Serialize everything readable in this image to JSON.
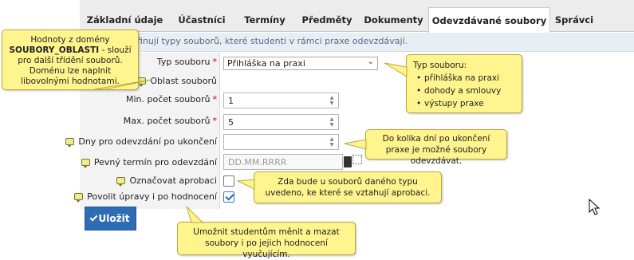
{
  "tabs": [
    {
      "label": "Základní údaje"
    },
    {
      "label": "Účastníci"
    },
    {
      "label": "Termíny"
    },
    {
      "label": "Předměty"
    },
    {
      "label": "Dokumenty"
    },
    {
      "label": "Odevzdávané soubory"
    },
    {
      "label": "Správci"
    }
  ],
  "active_tab": "Odevzdávané soubory",
  "info_text": "finují typy souborů, které studenti v rámci praxe odevzdávají.",
  "form": {
    "typ_souboru_label": "Typ souboru",
    "typ_souboru_value": "Přihláška na praxi",
    "oblast_label": "Oblast souborů",
    "min_label": "Min. počet souborů",
    "min_value": "1",
    "max_label": "Max. počet souborů",
    "max_value": "5",
    "dny_label": "Dny pro odevzdání po ukončení",
    "dny_value": "",
    "termin_label": "Pevný termín pro odevzdání",
    "termin_placeholder": "DD.MM.RRRR",
    "aprobace_label": "Označovat aprobaci",
    "aprobace_checked": false,
    "upravy_label": "Povolit úpravy i po hodnocení",
    "upravy_checked": true,
    "required_mark": "*"
  },
  "save_label": "Uložit",
  "tooltips": {
    "oblasti": {
      "line1": "Hodnoty z domény",
      "bold": "SOUBORY_OBLASTI",
      "rest": " - slouží pro další třídění souborů. Doménu lze naplnit libovolnými hodnotami."
    },
    "typ": {
      "title": "Typ souboru:",
      "items": [
        "přihláška na praxi",
        "dohody a smlouvy",
        "výstupy praxe"
      ]
    },
    "dny": "Do kolika dní po ukončení praxe je možné soubory odevzdávat.",
    "aprobace": "Zda bude u souborů daného typu uvedeno, ke které se vztahují aprobaci.",
    "upravy": "Umožnit studentům měnit a mazat soubory i po jejich hodnocení vyučujícím."
  },
  "colors": {
    "tooltip_bg": "#fff48e",
    "save_button": "#2e6db4",
    "tab_bar": "#ececec"
  }
}
